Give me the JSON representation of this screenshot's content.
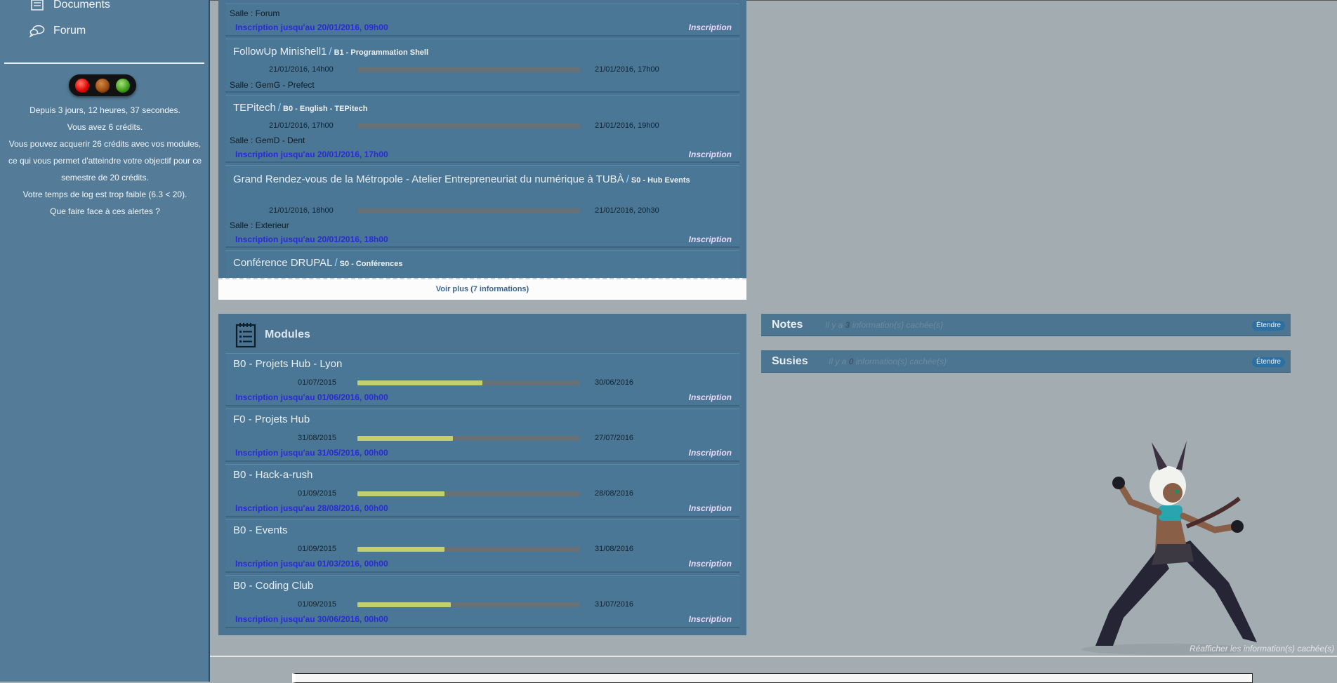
{
  "sidebar": {
    "nav": {
      "documents": "Documents",
      "forum": "Forum"
    },
    "alerts": [
      "Depuis 3 jours, 12 heures, 37 secondes.",
      "Vous avez 6 crédits.",
      "Vous pouvez acquerir 26 crédits avec vos modules, ce qui vous permet d'atteindre votre objectif pour ce semestre de 20 crédits.",
      "Votre temps de log est trop faible (6.3 < 20).",
      "Que faire face à ces alertes ?"
    ]
  },
  "events": {
    "items": [
      {
        "salle": "Salle : Forum",
        "deadline": "Inscription jusqu'au 20/01/2016, 09h00",
        "action": "Inscription"
      },
      {
        "title": "FollowUp Minishell1",
        "module": "B1 - Programmation Shell",
        "start": "21/01/2016, 14h00",
        "end": "21/01/2016, 17h00",
        "salle": "Salle : GemG - Prefect"
      },
      {
        "title": "TEPitech",
        "module": "B0 - English - TEPitech",
        "start": "21/01/2016, 17h00",
        "end": "21/01/2016, 19h00",
        "salle": "Salle : GemD - Dent",
        "deadline": "Inscription jusqu'au 20/01/2016, 17h00",
        "action": "Inscription"
      },
      {
        "title": "Grand Rendez-vous de la Métropole - Atelier Entrepreneuriat du numérique à TUBÀ",
        "module": "S0 - Hub Events",
        "start": "21/01/2016, 18h00",
        "end": "21/01/2016, 20h30",
        "salle": "Salle : Exterieur",
        "deadline": "Inscription jusqu'au 20/01/2016, 18h00",
        "action": "Inscription"
      },
      {
        "title": "Conférence DRUPAL",
        "module": "S0 - Conférences"
      }
    ],
    "more": "Voir plus (7 informations)"
  },
  "modules": {
    "title": "Modules",
    "items": [
      {
        "title": "B0 - Projets Hub - Lyon",
        "start": "01/07/2015",
        "end": "30/06/2016",
        "progress": 0.56,
        "deadline": "Inscription jusqu'au 01/06/2016, 00h00",
        "action": "Inscription"
      },
      {
        "title": "F0 - Projets Hub",
        "start": "31/08/2015",
        "end": "27/07/2016",
        "progress": 0.43,
        "deadline": "Inscription jusqu'au 31/05/2016, 00h00",
        "action": "Inscription"
      },
      {
        "title": "B0 - Hack-a-rush",
        "start": "01/09/2015",
        "end": "28/08/2016",
        "progress": 0.39,
        "deadline": "Inscription jusqu'au 28/08/2016, 00h00",
        "action": "Inscription"
      },
      {
        "title": "B0 - Events",
        "start": "01/09/2015",
        "end": "31/08/2016",
        "progress": 0.39,
        "deadline": "Inscription jusqu'au 01/03/2016, 00h00",
        "action": "Inscription"
      },
      {
        "title": "B0 - Coding Club",
        "start": "01/09/2015",
        "end": "31/07/2016",
        "progress": 0.42,
        "deadline": "Inscription jusqu'au 30/06/2016, 00h00",
        "action": "Inscription"
      }
    ]
  },
  "widgets": {
    "notes": {
      "title": "Notes",
      "info_prefix": "Il y a ",
      "count": "3",
      "info_suffix": " information(s) cachée(s)",
      "button": "Étendre"
    },
    "susies": {
      "title": "Susies",
      "info_prefix": "Il y a ",
      "count": "0",
      "info_suffix": " information(s) cachée(s)",
      "button": "Étendre"
    }
  },
  "restore": "Réafficher les information(s) cachée(s)",
  "colors": {
    "sidebar": "#547c98",
    "panel": "#4a7491",
    "deadline": "#2b2ad8",
    "inscription": "#ecd9ff",
    "progress": "#c2cf6c"
  }
}
